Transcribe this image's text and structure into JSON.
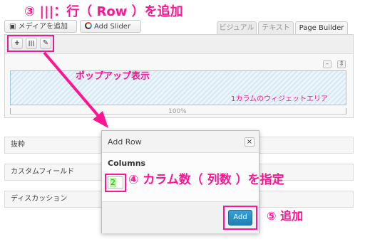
{
  "annotations": {
    "title": "③ |||：行（ Row ）を追加",
    "popup": "ポップアップ表示",
    "widget_area": "1カラムのウィジェットエリア",
    "columns": "④ カラム数（ 列数 ）を指定",
    "add": "⑤ 追加"
  },
  "toolbar": {
    "media_label": "メディアを追加",
    "slider_label": "Add Slider"
  },
  "tabs": [
    "ビジュアル",
    "テキスト",
    "Page Builder"
  ],
  "builder": {
    "buttons": [
      "+",
      "|||",
      "✎"
    ],
    "width_label": "100%"
  },
  "metaboxes": [
    "抜粋",
    "カスタムフィールド",
    "ディスカッション"
  ],
  "modal": {
    "title": "Add Row",
    "close": "×",
    "columns_label": "Columns",
    "columns_value": "2",
    "add_label": "Add"
  },
  "colors": {
    "annotation": "#ff1493",
    "primary_button": "#2a8fc8"
  }
}
